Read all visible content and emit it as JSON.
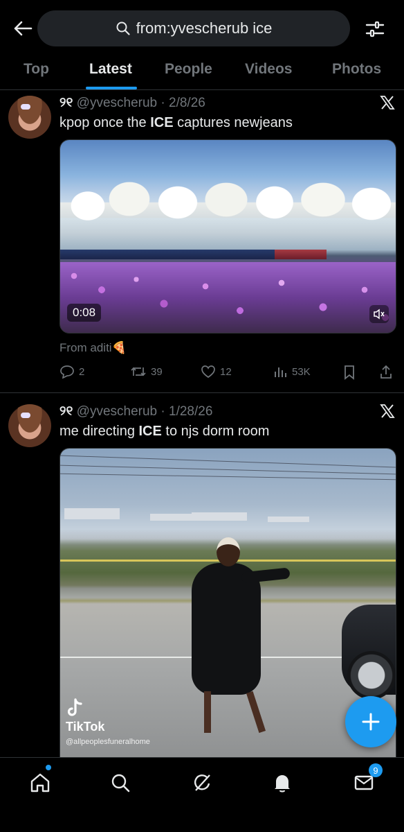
{
  "header": {
    "back_icon": "arrow-left-icon",
    "search_query": "from:yvescherub ice",
    "filter_icon": "sliders-icon"
  },
  "tabs": [
    {
      "label": "Top",
      "active": false
    },
    {
      "label": "Latest",
      "active": true
    },
    {
      "label": "People",
      "active": false
    },
    {
      "label": "Videos",
      "active": false
    },
    {
      "label": "Photos",
      "active": false
    }
  ],
  "tweets": [
    {
      "display_name": "୨୧",
      "handle": "@yvescherub",
      "date": "2/8/26",
      "text_before": "kpop once the ",
      "text_bold": "ICE",
      "text_after": " captures newjeans",
      "video_time": "0:08",
      "attribution": "From aditi🍕",
      "replies": "2",
      "reposts": "39",
      "likes": "12",
      "views": "53K"
    },
    {
      "display_name": "୨୧",
      "handle": "@yvescherub",
      "date": "1/28/26",
      "text_before": "me directing ",
      "text_bold": "ICE",
      "text_after": " to njs dorm room",
      "watermark_brand": "TikTok",
      "watermark_handle": "@allpeoplesfuneralhome"
    }
  ],
  "bottom_nav": {
    "items": [
      "home-icon",
      "search-icon",
      "grok-icon",
      "notifications-icon",
      "messages-icon"
    ],
    "messages_badge": "9"
  },
  "colors": {
    "accent": "#1d9bf0",
    "background": "#000000",
    "muted_text": "#71767b"
  }
}
